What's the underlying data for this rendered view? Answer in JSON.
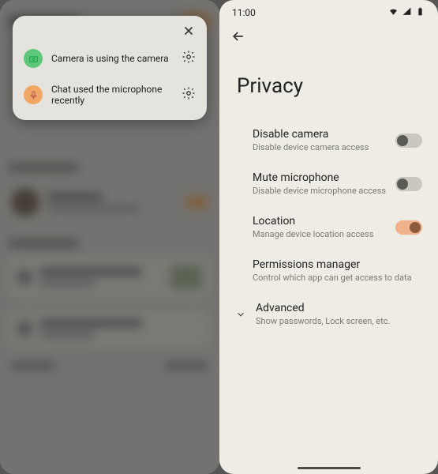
{
  "status": {
    "time": "11:00"
  },
  "popup": {
    "camera_text": "Camera is using the camera",
    "mic_text": "Chat used the microphone recently"
  },
  "privacy": {
    "title": "Privacy",
    "items": [
      {
        "label": "Disable camera",
        "sub": "Disable device camera access",
        "toggle": "off"
      },
      {
        "label": "Mute microphone",
        "sub": "Disable device microphone access",
        "toggle": "off"
      },
      {
        "label": "Location",
        "sub": "Manage device location access",
        "toggle": "on"
      },
      {
        "label": "Permissions manager",
        "sub": "Control which app can get access to data",
        "toggle": null
      },
      {
        "label": "Advanced",
        "sub": "Show passwords, Lock screen, etc.",
        "toggle": null,
        "expandable": true
      }
    ]
  }
}
